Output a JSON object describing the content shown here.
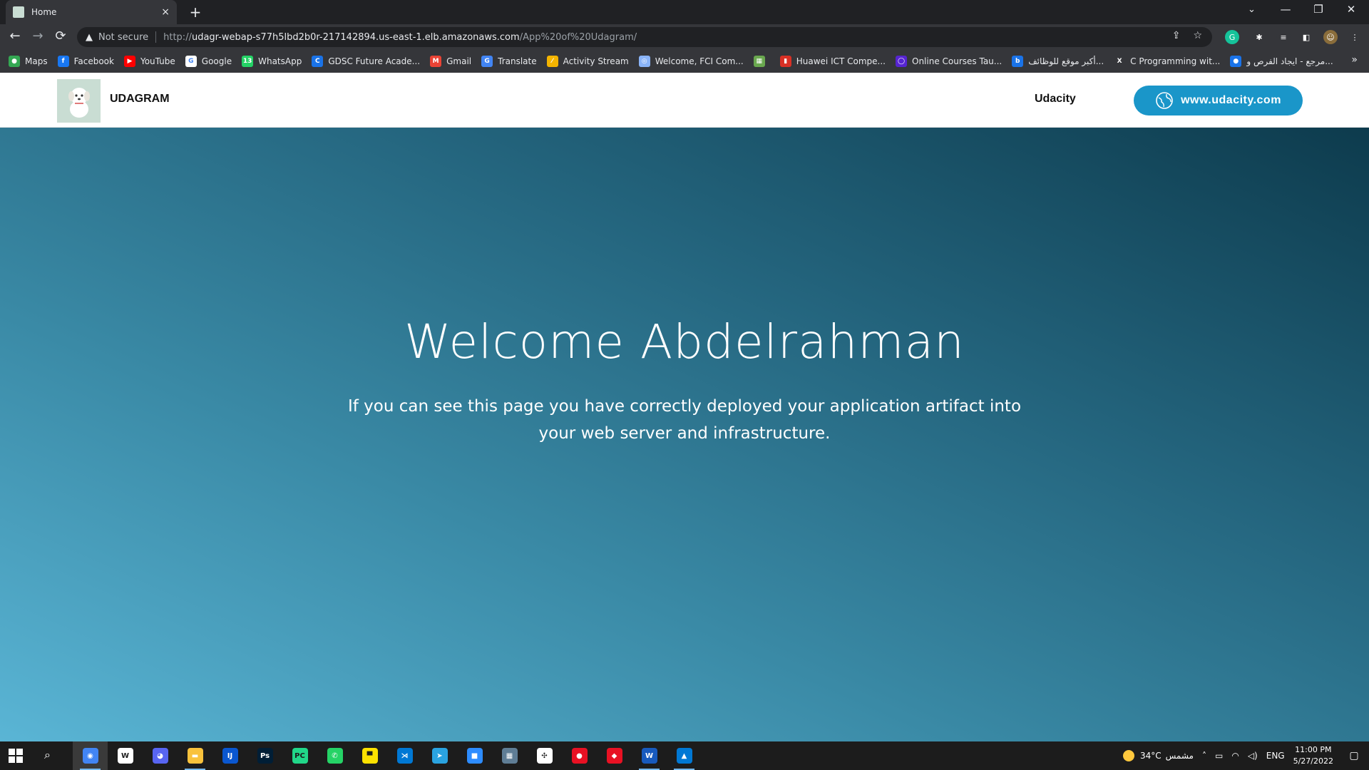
{
  "browser": {
    "tab": {
      "title": "Home",
      "close_glyph": "×"
    },
    "new_tab_glyph": "+",
    "window_controls": [
      "⌄",
      "—",
      "❐",
      "✕"
    ],
    "nav": {
      "back": "←",
      "forward": "→",
      "reload": "⟳"
    },
    "omnibox": {
      "security_label": "Not secure",
      "url_prefix": "http://",
      "url_host": "udagr-webap-s77h5lbd2b0r-217142894.us-east-1.elb.amazonaws.com",
      "url_path": "/App%20of%20Udagram/"
    },
    "omnibox_icons": [
      "share-icon",
      "star-icon"
    ],
    "extensions": [
      {
        "name": "grammarly-icon",
        "glyph": "G",
        "color": "#15c39a"
      },
      {
        "name": "puzzle-icon",
        "glyph": "✱",
        "color": "#35363a"
      },
      {
        "name": "media-icon",
        "glyph": "≡",
        "color": "#35363a"
      },
      {
        "name": "sidepanel-icon",
        "glyph": "◧",
        "color": "#35363a"
      },
      {
        "name": "profile-avatar",
        "glyph": "☺",
        "color": "#8a6d3b"
      },
      {
        "name": "menu-icon",
        "glyph": "⋮",
        "color": "#35363a"
      }
    ],
    "bookmarks": [
      {
        "label": "Maps",
        "icon": "maps-icon",
        "color": "#34a853",
        "glyph": "●"
      },
      {
        "label": "Facebook",
        "icon": "facebook-icon",
        "color": "#1877f2",
        "glyph": "f"
      },
      {
        "label": "YouTube",
        "icon": "youtube-icon",
        "color": "#ff0000",
        "glyph": "▶"
      },
      {
        "label": "Google",
        "icon": "google-icon",
        "color": "#ffffff",
        "glyph": "G"
      },
      {
        "label": "WhatsApp",
        "icon": "whatsapp-icon",
        "color": "#25d366",
        "glyph": "13"
      },
      {
        "label": "GDSC Future Acade...",
        "icon": "gdsc-icon",
        "color": "#1a73e8",
        "glyph": "C"
      },
      {
        "label": "Gmail",
        "icon": "gmail-icon",
        "color": "#ea4335",
        "glyph": "M"
      },
      {
        "label": "Translate",
        "icon": "translate-icon",
        "color": "#4285f4",
        "glyph": "G"
      },
      {
        "label": "Activity Stream",
        "icon": "activity-icon",
        "color": "#f4b400",
        "glyph": "⁄"
      },
      {
        "label": "Welcome, FCI Com...",
        "icon": "fci-icon",
        "color": "#8ab4f8",
        "glyph": "◎"
      },
      {
        "label": "",
        "icon": "image-bookmark-icon",
        "color": "#6aa84f",
        "glyph": "▦"
      },
      {
        "label": "Huawei ICT Compe...",
        "icon": "huawei-icon",
        "color": "#d93025",
        "glyph": "▮"
      },
      {
        "label": "Online Courses Tau...",
        "icon": "udemy-icon",
        "color": "#5624d0",
        "glyph": "◯"
      },
      {
        "label": "أكبر موقع للوظائف...",
        "icon": "jobs-icon",
        "color": "#1a73e8",
        "glyph": "b"
      },
      {
        "label": "C Programming wit...",
        "icon": "x-icon",
        "color": "#35363a",
        "glyph": "X"
      },
      {
        "label": "مرجع - ايجاد الفرص و...",
        "icon": "opportunities-icon",
        "color": "#1a73e8",
        "glyph": "●"
      }
    ],
    "bookmarks_overflow": "»"
  },
  "site": {
    "brand": "UDAGRAM",
    "nav_link": "Udacity",
    "cta_label": "www.udacity.com",
    "hero_title": "Welcome Abdelrahman",
    "hero_subtitle": "If you can see this page you have correctly deployed your application artifact into your web server and infrastructure."
  },
  "taskbar": {
    "apps": [
      {
        "name": "chrome-icon",
        "glyph": "◉",
        "color": "#4285f4",
        "active": true
      },
      {
        "name": "windows-app-icon",
        "glyph": "W",
        "color": "#ffffff"
      },
      {
        "name": "discord-icon",
        "glyph": "◕",
        "color": "#5865f2"
      },
      {
        "name": "file-explorer-icon",
        "glyph": "▬",
        "color": "#f9c23c",
        "running": true
      },
      {
        "name": "intellij-icon",
        "glyph": "IJ",
        "color": "#0a57d0"
      },
      {
        "name": "photoshop-icon",
        "glyph": "Ps",
        "color": "#001e36"
      },
      {
        "name": "pycharm-icon",
        "glyph": "PC",
        "color": "#21d789"
      },
      {
        "name": "whatsapp-taskbar-icon",
        "glyph": "✆",
        "color": "#25d366"
      },
      {
        "name": "sticky-notes-icon",
        "glyph": "▀",
        "color": "#fce100"
      },
      {
        "name": "vscode-icon",
        "glyph": "⋊",
        "color": "#0078d4"
      },
      {
        "name": "telegram-icon",
        "glyph": "➤",
        "color": "#2aa3e0"
      },
      {
        "name": "zoom-icon",
        "glyph": "■",
        "color": "#2d8cff"
      },
      {
        "name": "photos-app-icon",
        "glyph": "▦",
        "color": "#5f7d95"
      },
      {
        "name": "slack-icon",
        "glyph": "✣",
        "color": "#ffffff"
      },
      {
        "name": "screen-recorder-icon",
        "glyph": "●",
        "color": "#e81123"
      },
      {
        "name": "anydesk-icon",
        "glyph": "◆",
        "color": "#e81123"
      },
      {
        "name": "word-icon",
        "glyph": "W",
        "color": "#185abd",
        "running": true
      },
      {
        "name": "photos-icon",
        "glyph": "▲",
        "color": "#0078d4",
        "running": true
      }
    ],
    "weather_temp": "34°C",
    "weather_text": "مشمس",
    "language": "ENG",
    "time": "11:00 PM",
    "date": "5/27/2022"
  }
}
